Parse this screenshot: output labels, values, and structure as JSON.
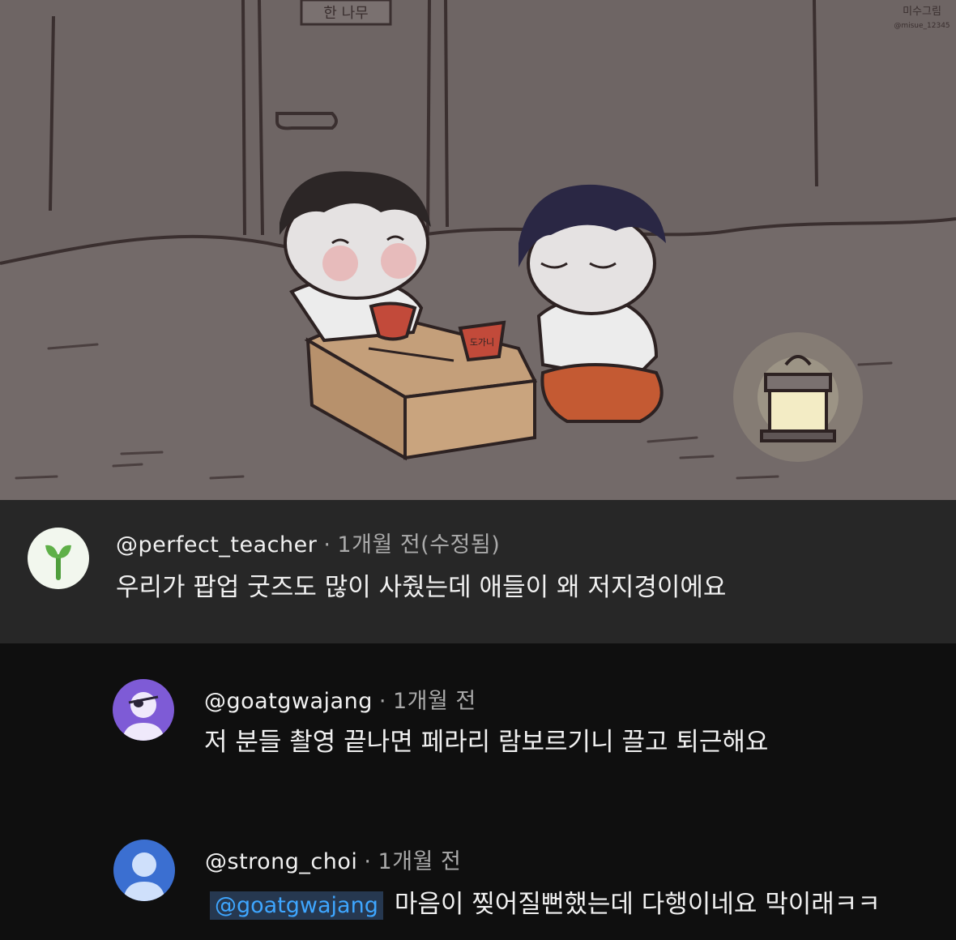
{
  "illustration": {
    "signature_line1": "미수그림",
    "signature_line2": "@misue_12345",
    "door_sign": "한 나무",
    "cup_label": "도가니",
    "lantern": "lantern"
  },
  "comments": [
    {
      "handle": "@perfect_teacher",
      "separator": "·",
      "time": "1개월 전(수정됨)",
      "text": "우리가 팝업 굿즈도 많이 사줬는데 애들이 왜 저지경이에요",
      "avatar_icon": "sprout-icon",
      "highlighted": true
    },
    {
      "handle": "@goatgwajang",
      "separator": "·",
      "time": "1개월 전",
      "text": "저 분들 촬영 끝나면 페라리 람보르기니 끌고 퇴근해요",
      "avatar_icon": "eyepatch-user-icon",
      "avatar_color": "#7e5bd6"
    },
    {
      "handle": "@strong_choi",
      "separator": "·",
      "time": "1개월 전",
      "mention": "@goatgwajang",
      "text": "마음이 찢어질뻔했는데 다행이네요 막이래ㅋㅋ",
      "avatar_icon": "default-user-icon",
      "avatar_color": "#3b6fd1"
    }
  ]
}
